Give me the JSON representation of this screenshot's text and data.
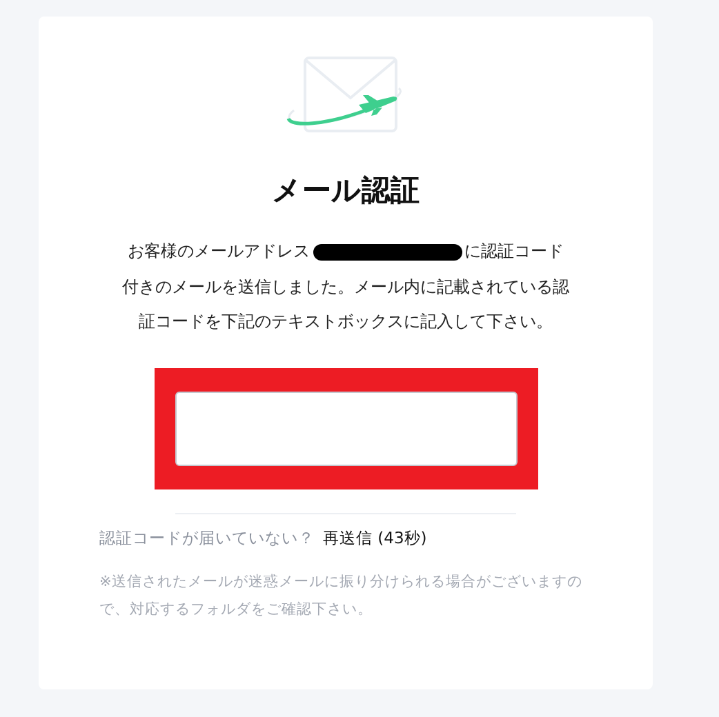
{
  "title": "メール認証",
  "message": {
    "before": "お客様のメールアドレス",
    "redacted": true,
    "after": "に認証コード",
    "lines": [
      "付きのメールを送信しました。メール内に記載されている認",
      "証コードを下記のテキストボックスに記入して下さい。"
    ]
  },
  "code_field": {
    "highlighted": true
  },
  "resend": {
    "prompt": "認証コードが届いていない？",
    "link": "再送信 (43秒)"
  },
  "note": "※送信されたメールが迷惑メールに振り分けられる場合がございますので、対応するフォルダをご確認下さい。"
}
